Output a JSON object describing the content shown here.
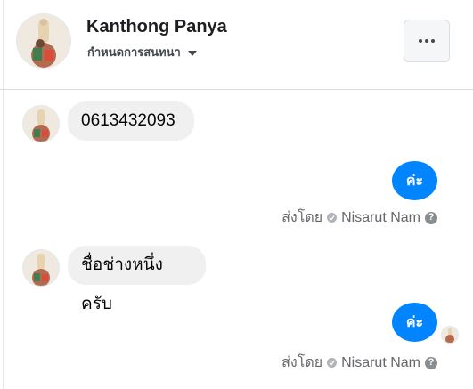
{
  "header": {
    "contact_name": "Kanthong Panya",
    "customize_label": "กำหนดการสนทนา"
  },
  "messages": {
    "in_1": "0613432093",
    "out_1": "ค่ะ",
    "sent_by_1": {
      "prefix": "ส่งโดย",
      "sender": "Nisarut Nam"
    },
    "in_2": "ชื่อช่างหนึ่งครับ",
    "out_2": "ค่ะ",
    "sent_by_2": {
      "prefix": "ส่งโดย",
      "sender": "Nisarut Nam"
    }
  },
  "icons": {
    "more": "more-options-icon",
    "caret": "chevron-down-icon",
    "help": "help-icon",
    "check": "check-icon"
  },
  "colors": {
    "accent": "#0084ff",
    "incoming_bubble": "#f0f0f0"
  }
}
